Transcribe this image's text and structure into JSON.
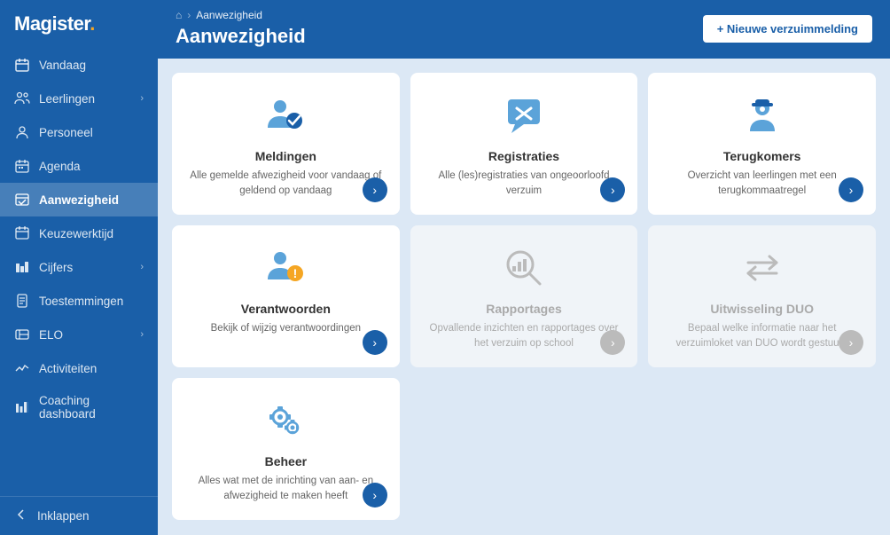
{
  "logo": {
    "text": "Magister",
    "dot": "."
  },
  "sidebar": {
    "items": [
      {
        "id": "vandaag",
        "label": "Vandaag",
        "icon": "calendar-today",
        "hasArrow": false
      },
      {
        "id": "leerlingen",
        "label": "Leerlingen",
        "icon": "students",
        "hasArrow": true
      },
      {
        "id": "personeel",
        "label": "Personeel",
        "icon": "person",
        "hasArrow": false
      },
      {
        "id": "agenda",
        "label": "Agenda",
        "icon": "agenda",
        "hasArrow": false
      },
      {
        "id": "aanwezigheid",
        "label": "Aanwezigheid",
        "icon": "aanwezigheid",
        "hasArrow": false,
        "active": true
      },
      {
        "id": "keuzewerktijd",
        "label": "Keuzewerktijd",
        "icon": "keuze",
        "hasArrow": false
      },
      {
        "id": "cijfers",
        "label": "Cijfers",
        "icon": "cijfers",
        "hasArrow": true
      },
      {
        "id": "toestemmingen",
        "label": "Toestemmingen",
        "icon": "toestemmingen",
        "hasArrow": false
      },
      {
        "id": "elo",
        "label": "ELO",
        "icon": "elo",
        "hasArrow": true
      },
      {
        "id": "activiteiten",
        "label": "Activiteiten",
        "icon": "activiteiten",
        "hasArrow": false
      },
      {
        "id": "coaching",
        "label": "Coaching dashboard",
        "icon": "coaching",
        "hasArrow": false
      }
    ],
    "collapse_label": "Inklappen"
  },
  "header": {
    "breadcrumb_home": "⌂",
    "breadcrumb_sep": "›",
    "breadcrumb_current": "Aanwezigheid",
    "title": "Aanwezigheid",
    "new_button": "+ Nieuwe verzuimmelding"
  },
  "cards": [
    {
      "id": "meldingen",
      "title": "Meldingen",
      "desc": "Alle gemelde afwezigheid voor vandaag of geldend op vandaag",
      "disabled": false
    },
    {
      "id": "registraties",
      "title": "Registraties",
      "desc": "Alle (les)registraties van ongeoorloofd verzuim",
      "disabled": false
    },
    {
      "id": "terugkomers",
      "title": "Terugkomers",
      "desc": "Overzicht van leerlingen met een terugkommaatregel",
      "disabled": false
    },
    {
      "id": "verantwoorden",
      "title": "Verantwoorden",
      "desc": "Bekijk of wijzig verantwoordingen",
      "disabled": false
    },
    {
      "id": "rapportages",
      "title": "Rapportages",
      "desc": "Opvallende inzichten en rapportages over het verzuim op school",
      "disabled": true
    },
    {
      "id": "uitwisseling",
      "title": "Uitwisseling DUO",
      "desc": "Bepaal welke informatie naar het verzuimloket van DUO wordt gestuurd",
      "disabled": true
    },
    {
      "id": "beheer",
      "title": "Beheer",
      "desc": "Alles wat met de inrichting van aan- en afwezigheid te maken heeft",
      "disabled": false
    }
  ]
}
